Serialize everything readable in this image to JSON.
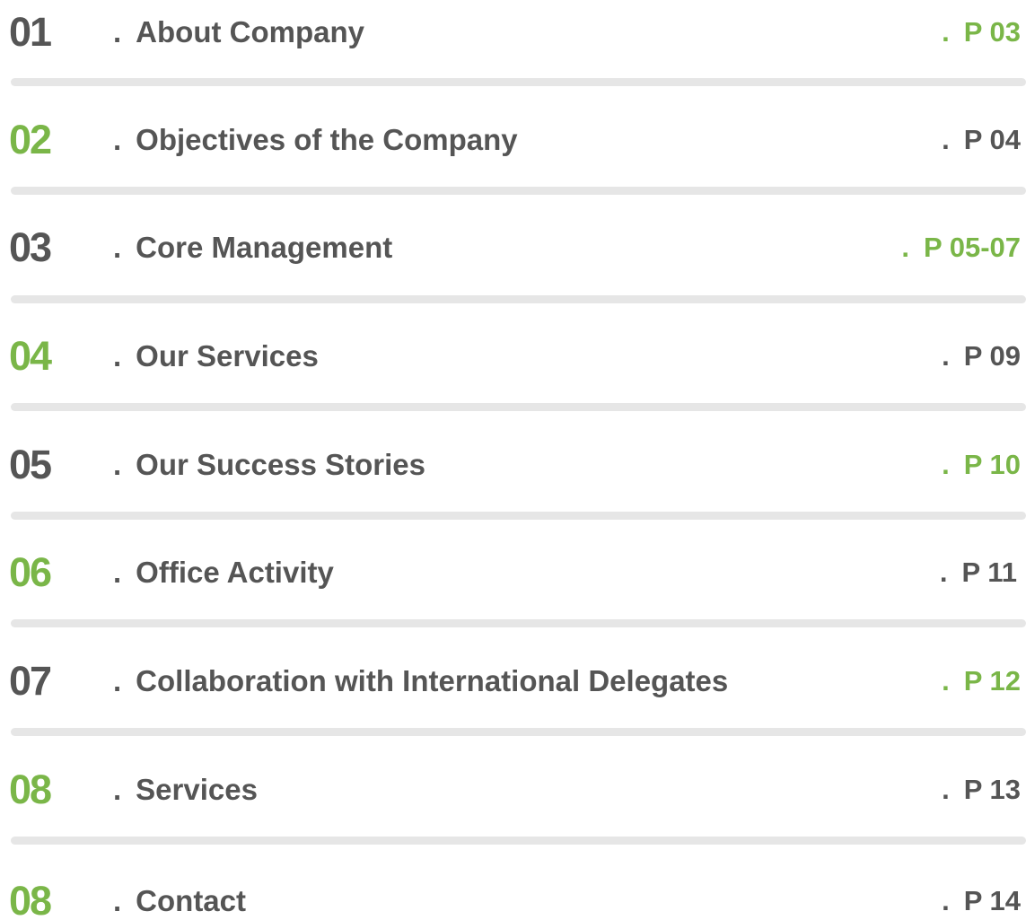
{
  "colors": {
    "text_gray": "#555555",
    "accent_green": "#7ab648",
    "divider": "#e6e6e6"
  },
  "toc": {
    "separator": ".",
    "items": [
      {
        "number": "01",
        "number_color": "gray",
        "title": "About Company",
        "page": "P 03",
        "page_color": "green"
      },
      {
        "number": "02",
        "number_color": "green",
        "title": "Objectives of the Company",
        "page": "P 04",
        "page_color": "gray"
      },
      {
        "number": "03",
        "number_color": "gray",
        "title": "Core Management",
        "page": "P 05-07",
        "page_color": "green"
      },
      {
        "number": "04",
        "number_color": "green",
        "title": "Our Services",
        "page": "P 09",
        "page_color": "gray"
      },
      {
        "number": "05",
        "number_color": "gray",
        "title": "Our Success Stories",
        "page": "P 10",
        "page_color": "green"
      },
      {
        "number": "06",
        "number_color": "green",
        "title": "Office Activity",
        "page": "P 11",
        "page_color": "gray"
      },
      {
        "number": "07",
        "number_color": "gray",
        "title": "Collaboration with International Delegates",
        "page": "P 12",
        "page_color": "green"
      },
      {
        "number": "08",
        "number_color": "green",
        "title": "Services",
        "page": "P 13",
        "page_color": "gray"
      },
      {
        "number": "08",
        "number_color": "green",
        "title": "Contact",
        "page": "P 14",
        "page_color": "gray"
      }
    ]
  }
}
